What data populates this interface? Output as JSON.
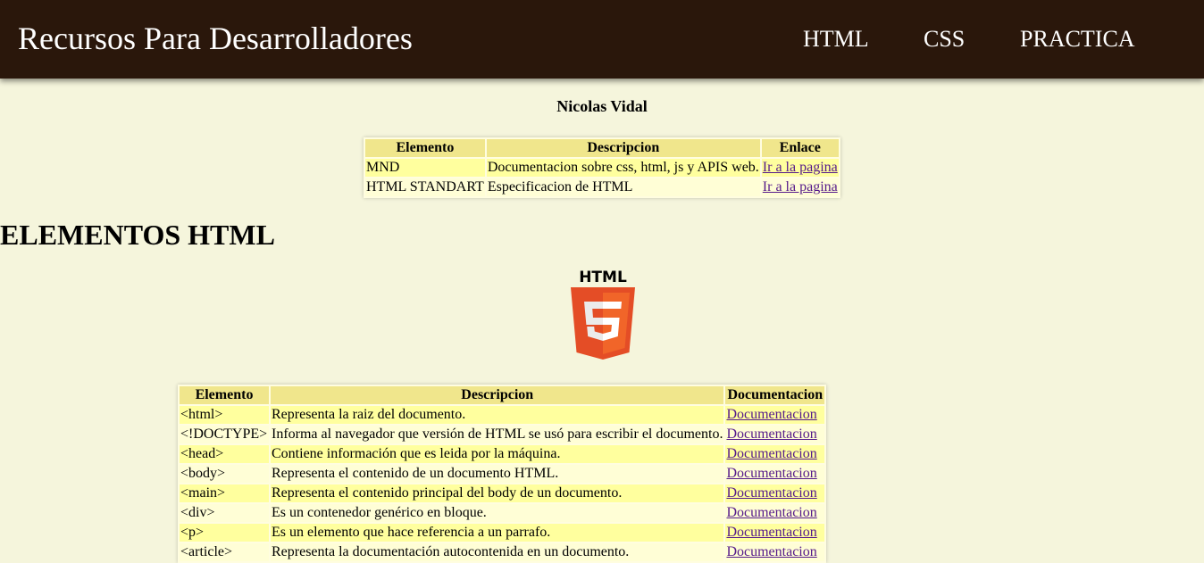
{
  "header": {
    "site_title": "Recursos Para Desarrolladores",
    "nav": [
      {
        "label": "HTML"
      },
      {
        "label": "CSS"
      },
      {
        "label": "PRACTICA"
      }
    ]
  },
  "author": "Nicolas Vidal",
  "resources_table": {
    "headers": [
      "Elemento",
      "Descripcion",
      "Enlace"
    ],
    "rows": [
      {
        "elemento": "MND",
        "descripcion": "Documentacion sobre css, html, js y APIS web.",
        "enlace": "Ir a la pagina"
      },
      {
        "elemento": "HTML STANDART",
        "descripcion": "Especificacion de HTML",
        "enlace": "Ir a la pagina"
      }
    ]
  },
  "section": {
    "heading": "ELEMENTOS HTML",
    "logo_icon": "html5-logo-icon",
    "logo_text": "HTML"
  },
  "elements_table": {
    "headers": [
      "Elemento",
      "Descripcion",
      "Documentacion"
    ],
    "rows": [
      {
        "elemento": "<html>",
        "descripcion": "Representa la raiz del documento.",
        "doc": "Documentacion"
      },
      {
        "elemento": "<!DOCTYPE>",
        "descripcion": "Informa al navegador que versión de HTML se usó para escribir el documento.",
        "doc": "Documentacion"
      },
      {
        "elemento": "<head>",
        "descripcion": "Contiene información que es leida por la máquina.",
        "doc": "Documentacion"
      },
      {
        "elemento": "<body>",
        "descripcion": "Representa el contenido de un documento HTML.",
        "doc": "Documentacion"
      },
      {
        "elemento": "<main>",
        "descripcion": "Representa el contenido principal del body de un documento.",
        "doc": "Documentacion"
      },
      {
        "elemento": "<div>",
        "descripcion": "Es un contenedor genérico en bloque.",
        "doc": "Documentacion"
      },
      {
        "elemento": "<p>",
        "descripcion": "Es un elemento que hace referencia a un parrafo.",
        "doc": "Documentacion"
      },
      {
        "elemento": "<article>",
        "descripcion": "Representa la documentación autocontenida en un documento.",
        "doc": "Documentacion"
      }
    ]
  },
  "colors": {
    "header_bg": "#2a170b",
    "page_bg": "#f5f5dc",
    "table_header_bg": "#f0e68c",
    "row_odd_bg": "#ffff9e",
    "row_even_bg": "#fffed6",
    "link": "#551a8b",
    "logo_orange": "#e44d26",
    "logo_orange_light": "#f16529"
  }
}
